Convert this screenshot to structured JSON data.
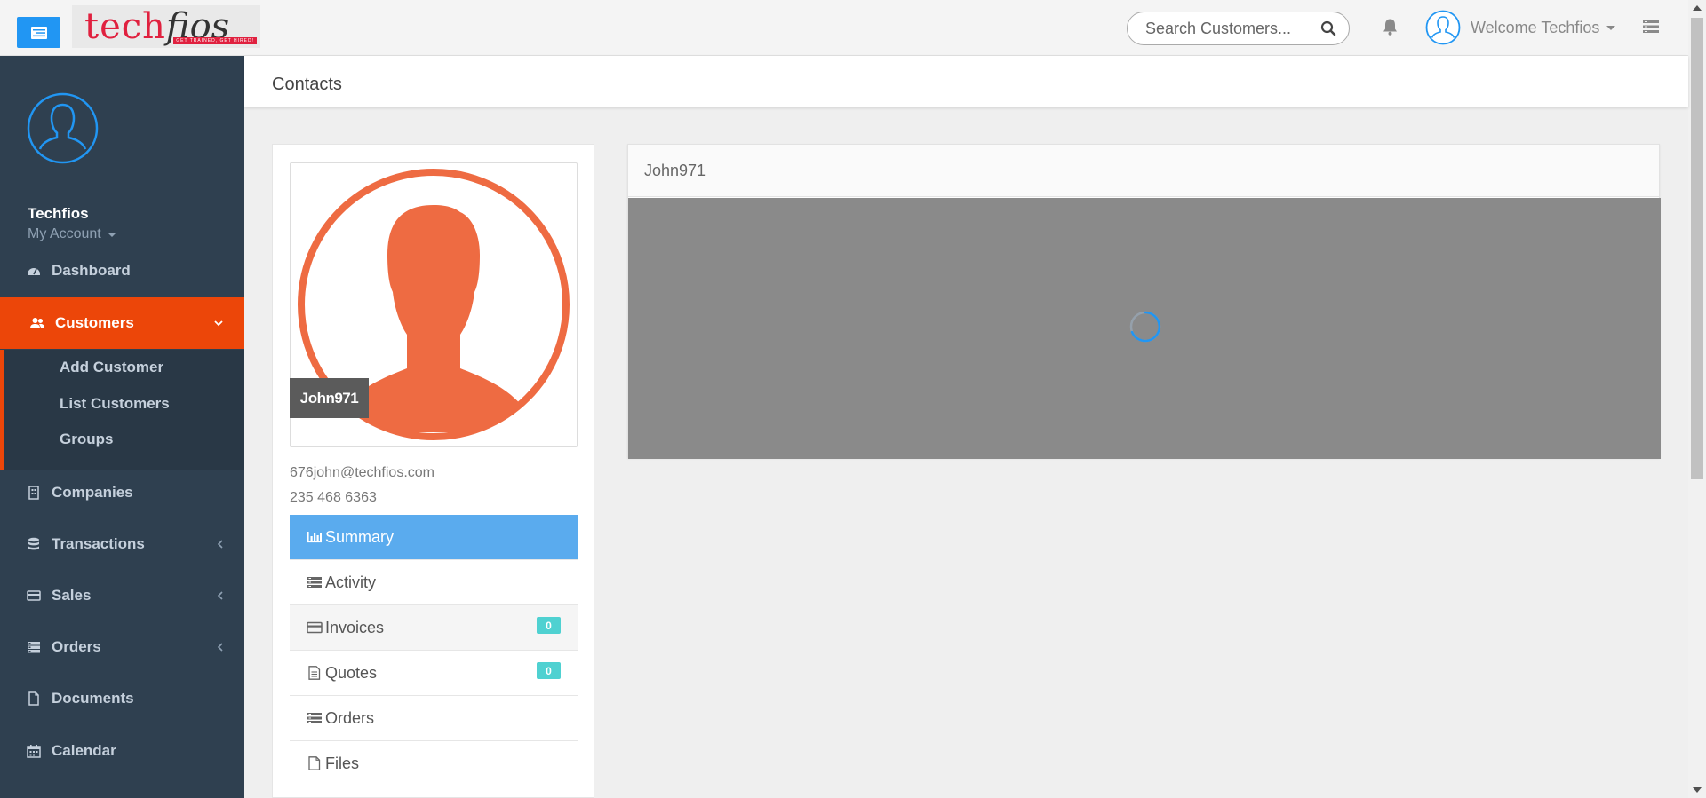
{
  "topbar": {
    "logo_main": "tech",
    "logo_accent": "fios",
    "logo_tagline": "GET TRAINED, GET HIRED!",
    "search_placeholder": "Search Customers...",
    "welcome_text": "Welcome Techfios"
  },
  "sidebar": {
    "user_name": "Techfios",
    "account_label": "My Account",
    "items": [
      {
        "label": "Dashboard",
        "icon": "dashboard-icon"
      },
      {
        "label": "Customers",
        "icon": "users-icon",
        "active": true
      },
      {
        "label": "Companies",
        "icon": "building-icon"
      },
      {
        "label": "Transactions",
        "icon": "database-icon"
      },
      {
        "label": "Sales",
        "icon": "credit-card-icon"
      },
      {
        "label": "Orders",
        "icon": "server-icon"
      },
      {
        "label": "Documents",
        "icon": "file-icon"
      },
      {
        "label": "Calendar",
        "icon": "calendar-icon"
      }
    ],
    "sub_items": [
      "Add Customer",
      "List Customers",
      "Groups"
    ]
  },
  "page": {
    "title": "Contacts"
  },
  "contact": {
    "name": "John971",
    "email": "676john@techfios.com",
    "phone": "235 468 6363",
    "menu": [
      {
        "label": "Summary",
        "icon": "bar-chart-icon"
      },
      {
        "label": "Activity",
        "icon": "list-icon"
      },
      {
        "label": "Invoices",
        "icon": "credit-card-icon",
        "badge": "0"
      },
      {
        "label": "Quotes",
        "icon": "file-text-icon",
        "badge": "0"
      },
      {
        "label": "Orders",
        "icon": "server-icon"
      },
      {
        "label": "Files",
        "icon": "file-icon"
      }
    ]
  },
  "panel": {
    "title": "John971"
  },
  "colors": {
    "accent": "#ec4609",
    "primary": "#2196f3",
    "sidebar_bg": "#2f4050",
    "active_menu": "#5aabee",
    "badge": "#4fd1d1",
    "avatar": "#ee6b42"
  }
}
